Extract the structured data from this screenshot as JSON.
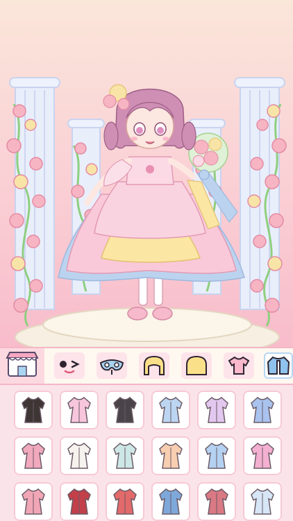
{
  "scene": {
    "colors": {
      "sky_top": "#fbe6da",
      "sky_bottom": "#f8bccb",
      "column": "#e9eefb",
      "rose": "#f7b5c4",
      "rose_yellow": "#f8e4a7",
      "leaf": "#8fcf7f"
    }
  },
  "character": {
    "colors": {
      "hair": "#cf8fb4",
      "dress": "#f9c9d9",
      "petticoat": "#fbe6a4",
      "bow": "#e88fb2",
      "skin": "#fde7e1",
      "eyes": "#e08fc0"
    }
  },
  "categories": [
    {
      "icon": "shop-icon",
      "active": false
    },
    {
      "icon": "face-wink-icon",
      "active": false
    },
    {
      "icon": "mask-icon",
      "active": false
    },
    {
      "icon": "hair-front-icon",
      "active": false
    },
    {
      "icon": "hair-back-icon",
      "active": false
    },
    {
      "icon": "shirt-icon",
      "active": false
    },
    {
      "icon": "jacket-icon",
      "active": true
    }
  ],
  "items": [
    {
      "icon": "black-coat-icon",
      "color": "#3e3535"
    },
    {
      "icon": "pink-dress-icon",
      "color": "#f7c6dc"
    },
    {
      "icon": "black-gothic-dress-icon",
      "color": "#4a4448"
    },
    {
      "icon": "blue-dress-icon",
      "color": "#bcd6f2"
    },
    {
      "icon": "lavender-gown-icon",
      "color": "#e2c7ee"
    },
    {
      "icon": "blue-frill-dress-icon",
      "color": "#a9c3ee"
    },
    {
      "icon": "pink-flower-dress-icon",
      "color": "#f0a9bd"
    },
    {
      "icon": "white-coat-icon",
      "color": "#f6f3ee"
    },
    {
      "icon": "mint-coat-icon",
      "color": "#cde7e6"
    },
    {
      "icon": "peach-cardigan-icon",
      "color": "#f8ceb1"
    },
    {
      "icon": "blue-jacket-icon",
      "color": "#b4d1f1"
    },
    {
      "icon": "pastel-sleeves-icon",
      "color": "#f3b0d0"
    },
    {
      "icon": "pink-ribbon-outfit-icon",
      "color": "#f1a6b6"
    },
    {
      "icon": "red-jacket-icon",
      "color": "#c2404a"
    },
    {
      "icon": "sailor-outfit-icon",
      "color": "#e26a6a"
    },
    {
      "icon": "denim-outfit-icon",
      "color": "#7ea8da"
    },
    {
      "icon": "coat-hanger-outfit-icon",
      "color": "#d97983"
    },
    {
      "icon": "blue-long-coat-icon",
      "color": "#d6e6f6"
    }
  ]
}
